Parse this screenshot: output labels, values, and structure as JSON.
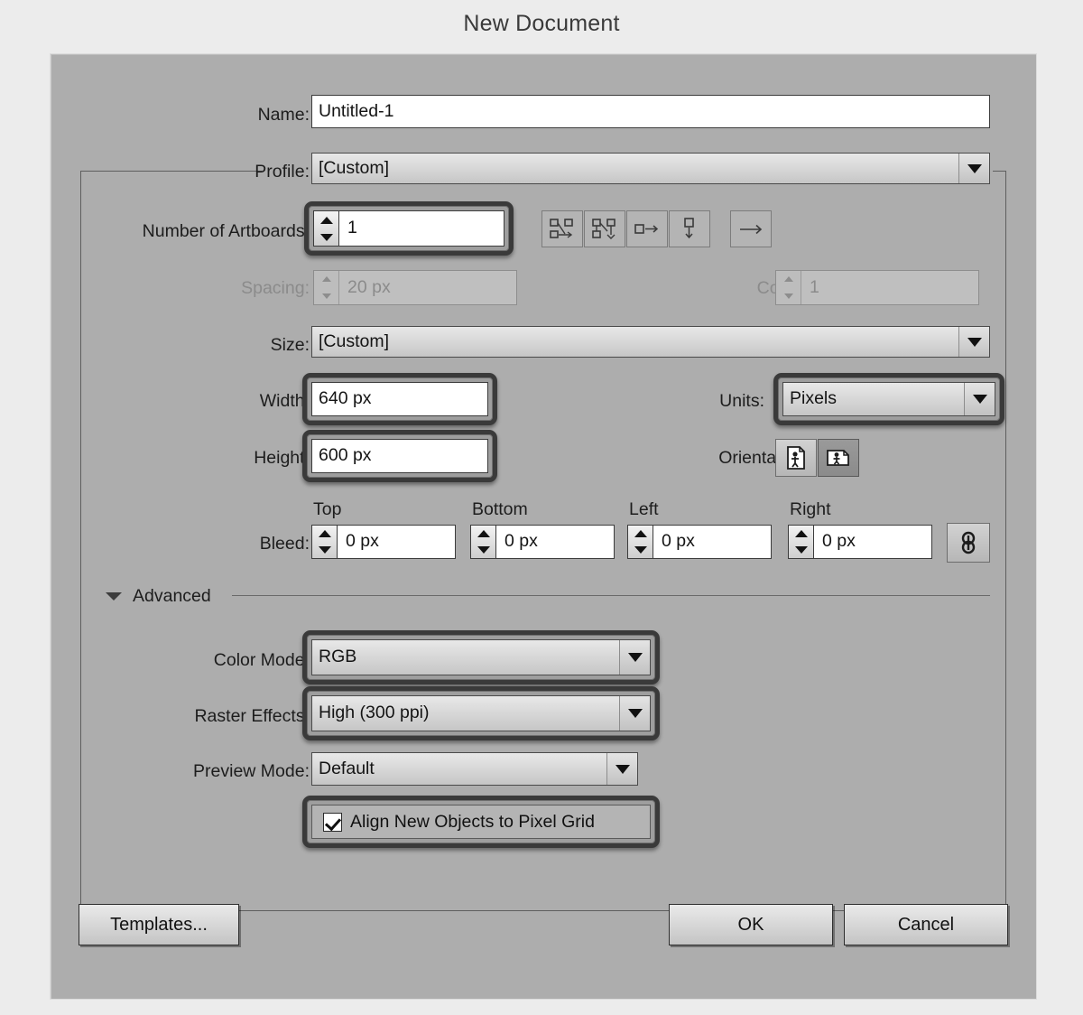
{
  "window": {
    "title": "New Document"
  },
  "fields": {
    "name": {
      "label": "Name:",
      "value": "Untitled-1"
    },
    "profile": {
      "label": "Profile:",
      "value": "[Custom]"
    },
    "num_artboards": {
      "label": "Number of Artboards:",
      "value": "1"
    },
    "spacing": {
      "label": "Spacing:",
      "value": "20 px"
    },
    "columns": {
      "label": "Columns:",
      "value": "1"
    },
    "size": {
      "label": "Size:",
      "value": "[Custom]"
    },
    "width": {
      "label": "Width:",
      "value": "640 px"
    },
    "height": {
      "label": "Height:",
      "value": "600 px"
    },
    "units": {
      "label": "Units:",
      "value": "Pixels"
    },
    "orientation": {
      "label": "Orientation:"
    },
    "bleed": {
      "label": "Bleed:",
      "columns": [
        "Top",
        "Bottom",
        "Left",
        "Right"
      ],
      "values": [
        "0 px",
        "0 px",
        "0 px",
        "0 px"
      ]
    },
    "color_mode": {
      "label": "Color Mode:",
      "value": "RGB"
    },
    "raster_effects": {
      "label": "Raster Effects:",
      "value": "High (300 ppi)"
    },
    "preview_mode": {
      "label": "Preview Mode:",
      "value": "Default"
    },
    "align_pixel_grid": {
      "label": "Align New Objects to Pixel Grid",
      "checked": true
    }
  },
  "sections": {
    "advanced": {
      "label": "Advanced",
      "expanded": true
    }
  },
  "artboard_layout_buttons": [
    {
      "name": "grid-by-row",
      "title": "Grid by Row"
    },
    {
      "name": "grid-by-column",
      "title": "Grid by Column"
    },
    {
      "name": "arrange-by-row",
      "title": "Arrange by Row"
    },
    {
      "name": "arrange-by-column",
      "title": "Arrange by Column"
    },
    {
      "name": "change-to-right-to-left-layout",
      "title": "Change to Right-to-Left Layout"
    }
  ],
  "orientation_buttons": [
    {
      "name": "portrait",
      "selected": false
    },
    {
      "name": "landscape",
      "selected": true
    }
  ],
  "bleed_link": {
    "name": "link-bleed-values",
    "linked": true
  },
  "buttons": {
    "templates": "Templates...",
    "ok": "OK",
    "cancel": "Cancel"
  },
  "colors": {
    "page_bg": "#ececec",
    "dialog_bg": "#adadad",
    "field_bg": "#ffffff",
    "text": "#1d1d1d",
    "disabled_text": "#8b8b8b",
    "highlight_ring": "#3a3a3a"
  }
}
